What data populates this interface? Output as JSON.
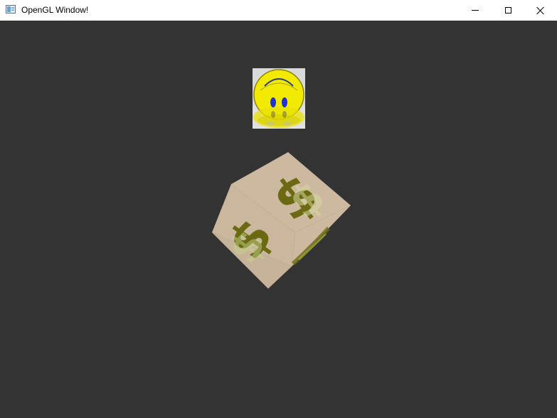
{
  "window": {
    "title": "OpenGL Window!",
    "icon": "app-window-icon",
    "controls": {
      "minimize": "minimize-icon",
      "maximize": "maximize-icon",
      "close": "close-icon"
    }
  },
  "scene": {
    "background_color": "#333333",
    "smiley_quad": {
      "texture": "smiley-face",
      "face_color": "#f2ea00",
      "eye_color": "#2233cc"
    },
    "cube": {
      "texture": "dollar-sign",
      "face_color": "#cdb9a0",
      "symbol_color": "#6b6a12",
      "symbol_text": "$"
    }
  }
}
